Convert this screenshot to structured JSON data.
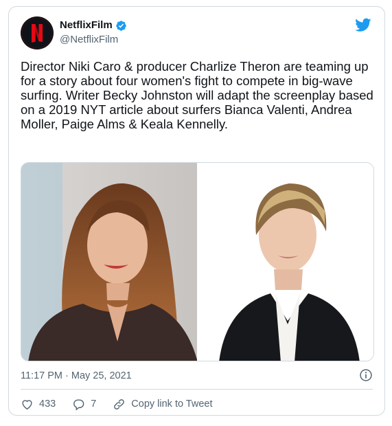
{
  "author": {
    "name": "NetflixFilm",
    "handle": "@NetflixFilm",
    "avatar_letter": "N",
    "verified": true
  },
  "tweet": {
    "text": "Director Niki Caro & producer Charlize Theron are teaming up for a story about four women's fight to compete in big-wave surfing. Writer Becky Johnston will adapt the screenplay based on a 2019 NYT article about surfers Bianca Valenti, Andrea Moller, Paige Alms & Keala Kennelly.",
    "timestamp": "11:17 PM · May 25, 2021"
  },
  "actions": {
    "likes": "433",
    "replies": "7",
    "copy_link": "Copy link to Tweet"
  },
  "colors": {
    "twitter_blue": "#1d9bf0",
    "netflix_red": "#e50914",
    "secondary_text": "#536471",
    "border": "#cfd9de"
  },
  "icons": [
    "twitter-bird-icon",
    "verified-badge-icon",
    "info-icon",
    "heart-icon",
    "reply-icon",
    "link-icon"
  ]
}
